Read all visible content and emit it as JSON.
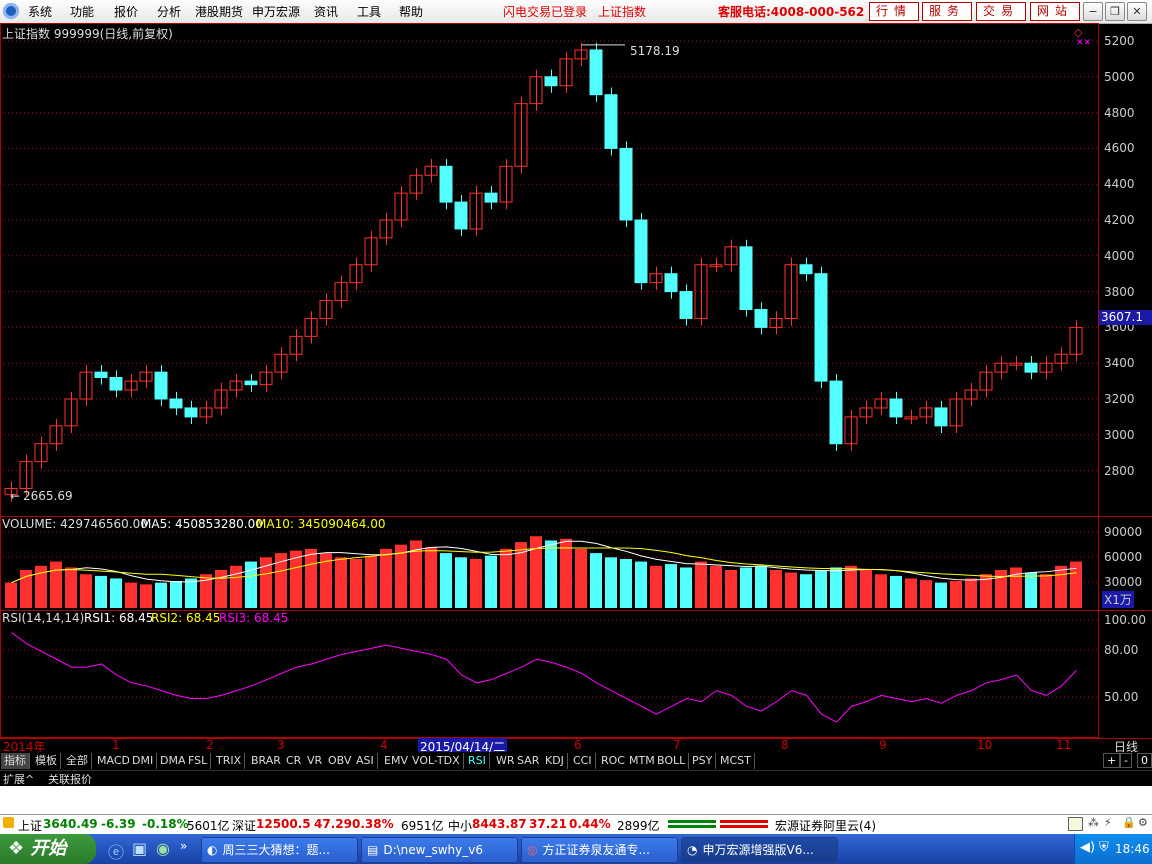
{
  "menu": {
    "items": [
      "系统",
      "功能",
      "报价",
      "分析",
      "港股期货",
      "申万宏源",
      "资讯",
      "工具",
      "帮助"
    ],
    "notice1": "闪电交易已登录",
    "notice2": "上证指数",
    "hotline": "客服电话:4008-000-562",
    "buttons": [
      "行情",
      "服务",
      "交易",
      "网站"
    ],
    "win_min": "−",
    "win_restore": "❐",
    "win_close": "✕"
  },
  "chart": {
    "title": "上证指数 999999(日线,前复权)",
    "price_ticks": [
      "5200",
      "5000",
      "4800",
      "4600",
      "4400",
      "4200",
      "4000",
      "3800",
      "3600",
      "3400",
      "3200",
      "3000",
      "2800"
    ],
    "current_price": "3607.1",
    "high_label": "5178.19",
    "low_label": "2665.69",
    "volume_header": {
      "label": "VOLUME: 429746560.00",
      "ma5": "MA5: 450853280.00",
      "ma10": "MA10: 345090464.00"
    },
    "volume_ticks": [
      "90000",
      "60000",
      "30000"
    ],
    "volume_unit": "X1万",
    "rsi_header": {
      "label": "RSI(14,14,14)",
      "rsi1": "RSI1: 68.45",
      "rsi2": "RSI2: 68.45",
      "rsi3": "RSI3: 68.45"
    },
    "rsi_ticks": [
      "100.00",
      "80.00",
      "50.00"
    ],
    "time_labels": [
      "2014年",
      "1",
      "2",
      "3",
      "4",
      "2015/04/14/二",
      "6",
      "7",
      "8",
      "9",
      "10",
      "11"
    ],
    "period": "日线",
    "colors": {
      "up": "#ff3030",
      "down": "#54ffff",
      "grid": "#b00000",
      "ma5": "#ffffff",
      "ma10": "#ffff00",
      "rsi": "#ff00ff"
    }
  },
  "tabs": [
    "指标",
    "模板",
    "全部",
    "MACD",
    "DMI",
    "DMA",
    "FSL",
    "TRIX",
    "BRAR",
    "CR",
    "VR",
    "OBV",
    "ASI",
    "EMV",
    "VOL-TDX",
    "RSI",
    "WR",
    "SAR",
    "KDJ",
    "CCI",
    "ROC",
    "MTM",
    "BOLL",
    "PSY",
    "MCST"
  ],
  "tab_controls": [
    "+",
    "-",
    "0"
  ],
  "row2": [
    "扩展^",
    "关联报价"
  ],
  "status": {
    "sh_label": "上证",
    "sh_val": "3640.49",
    "sh_chg": "-6.39",
    "sh_pct": "-0.18%",
    "sh_amt": "5601亿",
    "sz_label": "深证",
    "sz_val": "12500.5",
    "sz_chg": "47.29",
    "sz_pct": "0.38%",
    "sz_amt": "6951亿",
    "zx_label": "中小",
    "zx_val": "8443.87",
    "zx_chg": "37.21",
    "zx_pct": "0.44%",
    "zx_amt": "2899亿",
    "server": "宏源证券阿里云(4)"
  },
  "taskbar": {
    "start": "开始",
    "tasks": [
      "周三三大猜想：题...",
      "D:\\new_swhy_v6",
      "方正证券泉友通专...",
      "申万宏源增强版V6..."
    ],
    "clock": "18:46"
  },
  "chart_data": {
    "type": "candlestick",
    "period": "日线",
    "price_range": [
      2665.69,
      5178.19
    ],
    "closes_by_week": [
      2700,
      2850,
      2950,
      3050,
      3200,
      3350,
      3320,
      3250,
      3300,
      3350,
      3200,
      3150,
      3100,
      3150,
      3250,
      3300,
      3280,
      3350,
      3450,
      3550,
      3650,
      3750,
      3850,
      3950,
      4100,
      4200,
      4350,
      4450,
      4500,
      4300,
      4150,
      4350,
      4300,
      4500,
      4850,
      5000,
      4950,
      5100,
      5150,
      4900,
      4600,
      4200,
      3850,
      3900,
      3800,
      3650,
      3950,
      3950,
      4050,
      3700,
      3600,
      3650,
      3950,
      3900,
      3300,
      2950,
      3100,
      3150,
      3200,
      3100,
      3100,
      3150,
      3050,
      3200,
      3250,
      3350,
      3400,
      3400,
      3350,
      3400,
      3450,
      3600
    ],
    "volumes_by_week": [
      30,
      45,
      50,
      55,
      48,
      40,
      38,
      35,
      30,
      28,
      30,
      32,
      35,
      40,
      45,
      50,
      55,
      60,
      65,
      68,
      70,
      65,
      60,
      58,
      62,
      70,
      75,
      80,
      72,
      65,
      60,
      58,
      62,
      70,
      78,
      85,
      80,
      82,
      70,
      65,
      60,
      58,
      55,
      50,
      52,
      48,
      55,
      50,
      45,
      48,
      50,
      45,
      42,
      40,
      45,
      48,
      50,
      45,
      40,
      38,
      35,
      33,
      30,
      32,
      35,
      40,
      45,
      48,
      42,
      40,
      50,
      55
    ],
    "rsi": [
      92,
      85,
      80,
      75,
      70,
      70,
      72,
      65,
      60,
      58,
      55,
      52,
      50,
      50,
      52,
      55,
      58,
      62,
      66,
      70,
      72,
      75,
      78,
      80,
      82,
      84,
      82,
      80,
      78,
      75,
      65,
      60,
      62,
      66,
      70,
      75,
      73,
      70,
      66,
      60,
      55,
      50,
      45,
      40,
      45,
      50,
      48,
      55,
      52,
      45,
      42,
      48,
      55,
      52,
      40,
      35,
      45,
      48,
      52,
      50,
      48,
      50,
      47,
      52,
      55,
      60,
      62,
      65,
      55,
      52,
      58,
      68
    ]
  }
}
